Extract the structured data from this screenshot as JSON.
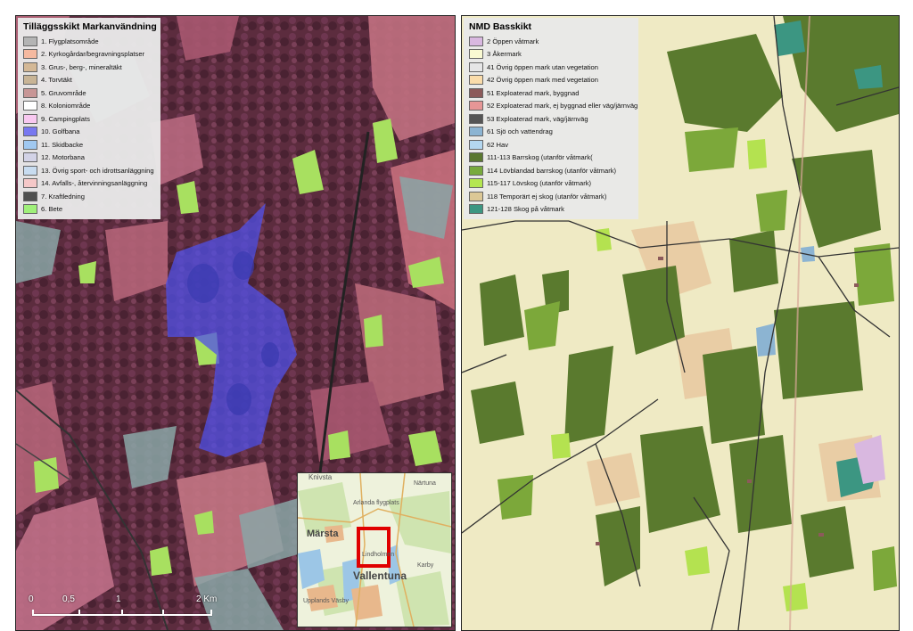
{
  "left_map": {
    "legend_title": "Tilläggsskikt Markanvändning",
    "legend": [
      {
        "label": "1. Flygplatsområde",
        "color": "#b4b4b4"
      },
      {
        "label": "2. Kyrkogårdar/begravningsplatser",
        "color": "#f5b9a0"
      },
      {
        "label": "3. Grus-, berg-, mineraltäkt",
        "color": "#d4b896"
      },
      {
        "label": "4. Torvtäkt",
        "color": "#c8b496"
      },
      {
        "label": "5. Gruvområde",
        "color": "#c89696"
      },
      {
        "label": "8. Koloniområde",
        "color": "#ffffff"
      },
      {
        "label": "9. Campingplats",
        "color": "#f8c8f0"
      },
      {
        "label": "10. Golfbana",
        "color": "#7878f0"
      },
      {
        "label": "11. Skidbacke",
        "color": "#a0c8f0"
      },
      {
        "label": "12. Motorbana",
        "color": "#d2d2e6"
      },
      {
        "label": "13. Övrig sport- och idrottsanläggning",
        "color": "#c8dcf0"
      },
      {
        "label": "14. Avfalls-, återvinningsanläggning",
        "color": "#f5c8c8"
      },
      {
        "label": "7. Kraftledning",
        "color": "#505050"
      },
      {
        "label": "6. Bete",
        "color": "#a0f07a"
      }
    ],
    "scale": {
      "labels": [
        "0",
        "0,5",
        "1",
        "2 Km"
      ]
    },
    "inset": {
      "places": [
        "Knivsta",
        "Närtuna",
        "Arlanda flygplats",
        "Märsta",
        "Lindholmen",
        "Karby",
        "Vallentuna",
        "Upplands Väsby"
      ]
    }
  },
  "right_map": {
    "legend_title": "NMD Basskikt",
    "legend": [
      {
        "label": "2 Öppen våtmark",
        "color": "#d9b8e0"
      },
      {
        "label": "3 Åkermark",
        "color": "#fafad2"
      },
      {
        "label": "41 Övrig öppen mark utan vegetation",
        "color": "#e6e6e6"
      },
      {
        "label": "42 Övrig öppen mark med vegetation",
        "color": "#fadcaa"
      },
      {
        "label": "51 Exploaterad mark, byggnad",
        "color": "#8c5a5a"
      },
      {
        "label": "52 Exploaterad mark, ej byggnad eller väg/järnväg",
        "color": "#e69696"
      },
      {
        "label": "53 Exploaterad mark, väg/järnväg",
        "color": "#555555"
      },
      {
        "label": "61 Sjö och vattendrag",
        "color": "#8cb4d2"
      },
      {
        "label": "62 Hav",
        "color": "#b4d7f0"
      },
      {
        "label": "111-113 Barrskog (utanför våtmark(",
        "color": "#5a7830"
      },
      {
        "label": "114 Lövblandad barrskog (utanför våtmark)",
        "color": "#78aa3c"
      },
      {
        "label": "115-117 Lövskog (utanför våtmark)",
        "color": "#b4e650"
      },
      {
        "label": "118 Temporärt ej skog (utanför våtmark)",
        "color": "#dcc896"
      },
      {
        "label": "121-128 Skog på våtmark",
        "color": "#3c9682"
      }
    ]
  }
}
